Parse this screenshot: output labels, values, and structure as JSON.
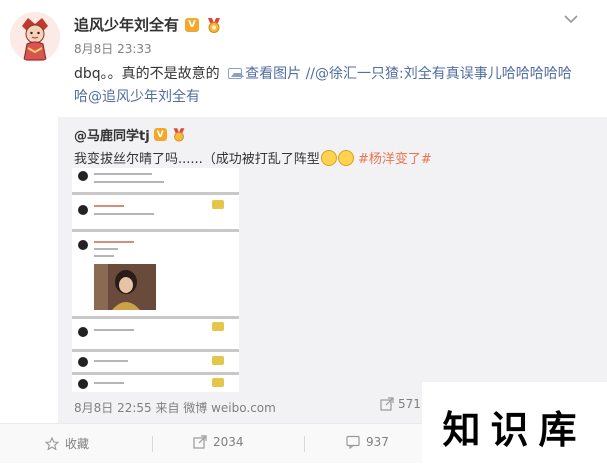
{
  "post": {
    "author": "追风少年刘全有",
    "verified_badge": "V",
    "time": "8月8日 23:33",
    "text_prefix": "dbq。。真的不是故意的",
    "view_image": "查看图片",
    "text_mid": " //",
    "mention_1": "@徐汇一只猹",
    "text_mid2": ":刘全有真误事儿哈哈哈哈哈哈",
    "mention_2": "@追风少年刘全有"
  },
  "repost": {
    "user": "@马鹿同学tj",
    "verified_badge": "V",
    "text": "我变拔丝尔晴了吗......（成功被打乱了阵型",
    "topic": "#杨洋变了#",
    "footer": "8月8日 22:55 来自 微博 weibo.com",
    "share_count": "571"
  },
  "actions": {
    "favorite": "收藏",
    "repost_count": "2034",
    "comment_count": "937"
  },
  "watermark": "知识库",
  "colors": {
    "link": "#eb7350",
    "blue_link": "#526ea3",
    "badge": "#f4a72b"
  }
}
